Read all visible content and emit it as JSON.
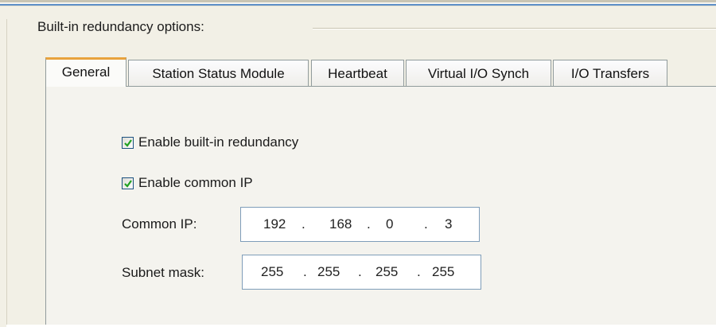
{
  "group": {
    "title": "Built-in redundancy options:"
  },
  "tabs": [
    {
      "label": "General",
      "active": true
    },
    {
      "label": "Station Status Module",
      "active": false
    },
    {
      "label": "Heartbeat",
      "active": false
    },
    {
      "label": "Virtual I/O Synch",
      "active": false
    },
    {
      "label": "I/O Transfers",
      "active": false
    }
  ],
  "general": {
    "enable_redundancy": {
      "label": "Enable built-in redundancy",
      "checked": true
    },
    "enable_common_ip": {
      "label": "Enable common IP",
      "checked": true
    },
    "common_ip": {
      "label": "Common IP:",
      "octets": [
        "192",
        "168",
        "0",
        "3"
      ]
    },
    "subnet_mask": {
      "label": "Subnet mask:",
      "octets": [
        "255",
        "255",
        "255",
        "255"
      ]
    }
  },
  "colors": {
    "active_tab_accent": "#e8a33d",
    "checkbox_check": "#21a121",
    "field_border": "#7f9db9"
  }
}
